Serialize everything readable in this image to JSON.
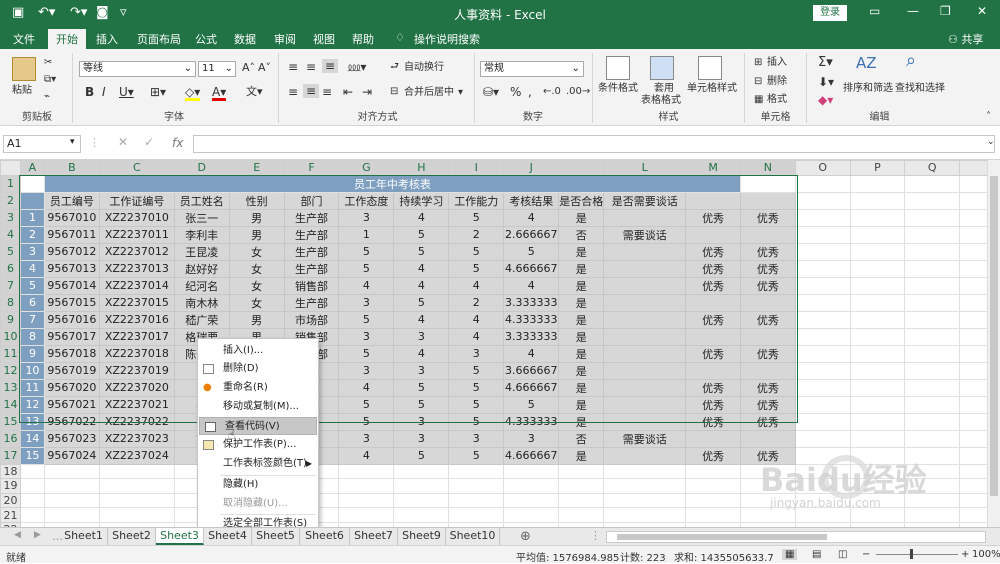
{
  "window": {
    "title": "人事资料 - Excel",
    "login": "登录"
  },
  "tabs": [
    "文件",
    "开始",
    "插入",
    "页面布局",
    "公式",
    "数据",
    "审阅",
    "视图",
    "帮助"
  ],
  "tellme": "操作说明搜索",
  "share": "共享",
  "ribbon": {
    "paste": "粘贴",
    "clipboard": "剪贴板",
    "font": "字体",
    "alignment": "对齐方式",
    "number": "数字",
    "styles": "样式",
    "cells": "单元格",
    "editing": "编辑",
    "font_name": "等线",
    "font_size": "11",
    "wrap": "自动换行",
    "merge": "合并后居中",
    "number_format": "常规",
    "cond_fmt": "条件格式",
    "table_fmt_1": "套用",
    "table_fmt_2": "表格格式",
    "cell_style": "单元格样式",
    "insert": "插入",
    "delete": "删除",
    "format": "格式",
    "sort": "排序和筛选",
    "find": "查找和选择"
  },
  "formula_bar": {
    "namebox": "A1",
    "fx": "fx",
    "value": ""
  },
  "columns": [
    "A",
    "B",
    "C",
    "D",
    "E",
    "F",
    "G",
    "H",
    "I",
    "J",
    "K",
    "L",
    "M",
    "N",
    "O",
    "P",
    "Q"
  ],
  "sheet_title": "员工年中考核表",
  "headers": [
    "员工编号",
    "工作证编号",
    "员工姓名",
    "性别",
    "部门",
    "工作态度",
    "持续学习",
    "工作能力",
    "考核结果",
    "是否合格",
    "是否需要谈话",
    "",
    ""
  ],
  "rows": [
    [
      "1",
      "9567010",
      "XZ2237010",
      "张三一",
      "男",
      "生产部",
      "3",
      "4",
      "5",
      "4",
      "是",
      "",
      "优秀",
      "优秀"
    ],
    [
      "2",
      "9567011",
      "XZ2237011",
      "李利丰",
      "男",
      "生产部",
      "1",
      "5",
      "2",
      "2.666667",
      "否",
      "需要谈话",
      "",
      ""
    ],
    [
      "3",
      "9567012",
      "XZ2237012",
      "王昆凌",
      "女",
      "生产部",
      "5",
      "5",
      "5",
      "5",
      "是",
      "",
      "优秀",
      "优秀"
    ],
    [
      "4",
      "9567013",
      "XZ2237013",
      "赵好好",
      "女",
      "生产部",
      "5",
      "4",
      "5",
      "4.666667",
      "是",
      "",
      "优秀",
      "优秀"
    ],
    [
      "5",
      "9567014",
      "XZ2237014",
      "纪河名",
      "女",
      "销售部",
      "4",
      "4",
      "4",
      "4",
      "是",
      "",
      "优秀",
      "优秀"
    ],
    [
      "6",
      "9567015",
      "XZ2237015",
      "南木林",
      "女",
      "生产部",
      "3",
      "5",
      "2",
      "3.333333",
      "是",
      "",
      "",
      ""
    ],
    [
      "7",
      "9567016",
      "XZ2237016",
      "嵇广荣",
      "男",
      "市场部",
      "5",
      "4",
      "4",
      "4.333333",
      "是",
      "",
      "优秀",
      "优秀"
    ],
    [
      "8",
      "9567017",
      "XZ2237017",
      "格瑞要",
      "男",
      "销售部",
      "3",
      "3",
      "4",
      "3.333333",
      "是",
      "",
      "",
      ""
    ],
    [
      "9",
      "9567018",
      "XZ2237018",
      "陈健康",
      "男",
      "财务部",
      "5",
      "4",
      "3",
      "4",
      "是",
      "",
      "优秀",
      "优秀"
    ],
    [
      "10",
      "9567019",
      "XZ2237019",
      "陈",
      "",
      "部",
      "3",
      "3",
      "5",
      "3.666667",
      "是",
      "",
      "",
      ""
    ],
    [
      "11",
      "9567020",
      "XZ2237020",
      "高",
      "",
      "部",
      "4",
      "5",
      "5",
      "4.666667",
      "是",
      "",
      "优秀",
      "优秀"
    ],
    [
      "12",
      "9567021",
      "XZ2237021",
      "郝",
      "",
      "部",
      "5",
      "5",
      "5",
      "5",
      "是",
      "",
      "优秀",
      "优秀"
    ],
    [
      "13",
      "9567022",
      "XZ2237022",
      "刘",
      "",
      "部",
      "5",
      "3",
      "5",
      "4.333333",
      "是",
      "",
      "优秀",
      "优秀"
    ],
    [
      "14",
      "9567023",
      "XZ2237023",
      "刘",
      "",
      "部",
      "3",
      "3",
      "3",
      "3",
      "否",
      "需要谈话",
      "",
      ""
    ],
    [
      "15",
      "9567024",
      "XZ2237024",
      "王",
      "",
      "部",
      "4",
      "5",
      "5",
      "4.666667",
      "是",
      "",
      "优秀",
      "优秀"
    ]
  ],
  "context_menu": [
    {
      "label": "插入(I)...",
      "icon": "",
      "disabled": false
    },
    {
      "label": "删除(D)",
      "icon": "delete-sheet-icon",
      "disabled": false
    },
    {
      "label": "重命名(R)",
      "icon": "rename-icon",
      "disabled": false
    },
    {
      "label": "移动或复制(M)...",
      "icon": "",
      "disabled": false
    },
    {
      "label": "查看代码(V)",
      "icon": "view-code-icon",
      "disabled": false,
      "highlight": true
    },
    {
      "label": "保护工作表(P)...",
      "icon": "protect-sheet-icon",
      "disabled": false
    },
    {
      "label": "工作表标签颜色(T)",
      "icon": "",
      "disabled": false,
      "submenu": true
    },
    {
      "label": "隐藏(H)",
      "icon": "",
      "disabled": false
    },
    {
      "label": "取消隐藏(U)...",
      "icon": "",
      "disabled": true
    },
    {
      "label": "选定全部工作表(S)",
      "icon": "",
      "disabled": false
    }
  ],
  "sheets": [
    "Sheet1",
    "Sheet2",
    "Sheet3",
    "Sheet4",
    "Sheet5",
    "Sheet6",
    "Sheet7",
    "Sheet9",
    "Sheet10"
  ],
  "active_sheet": "Sheet3",
  "status": {
    "ready": "就绪",
    "average": "平均值: 1576984.985",
    "count": "计数: 223",
    "sum": "求和: 1435505633.7",
    "zoom": "100%"
  },
  "watermark": {
    "text": "Baidu经验",
    "url": "jingyan.baidu.com"
  },
  "colors": {
    "excel_green": "#217346",
    "header_fill": "#7f9fc0"
  }
}
